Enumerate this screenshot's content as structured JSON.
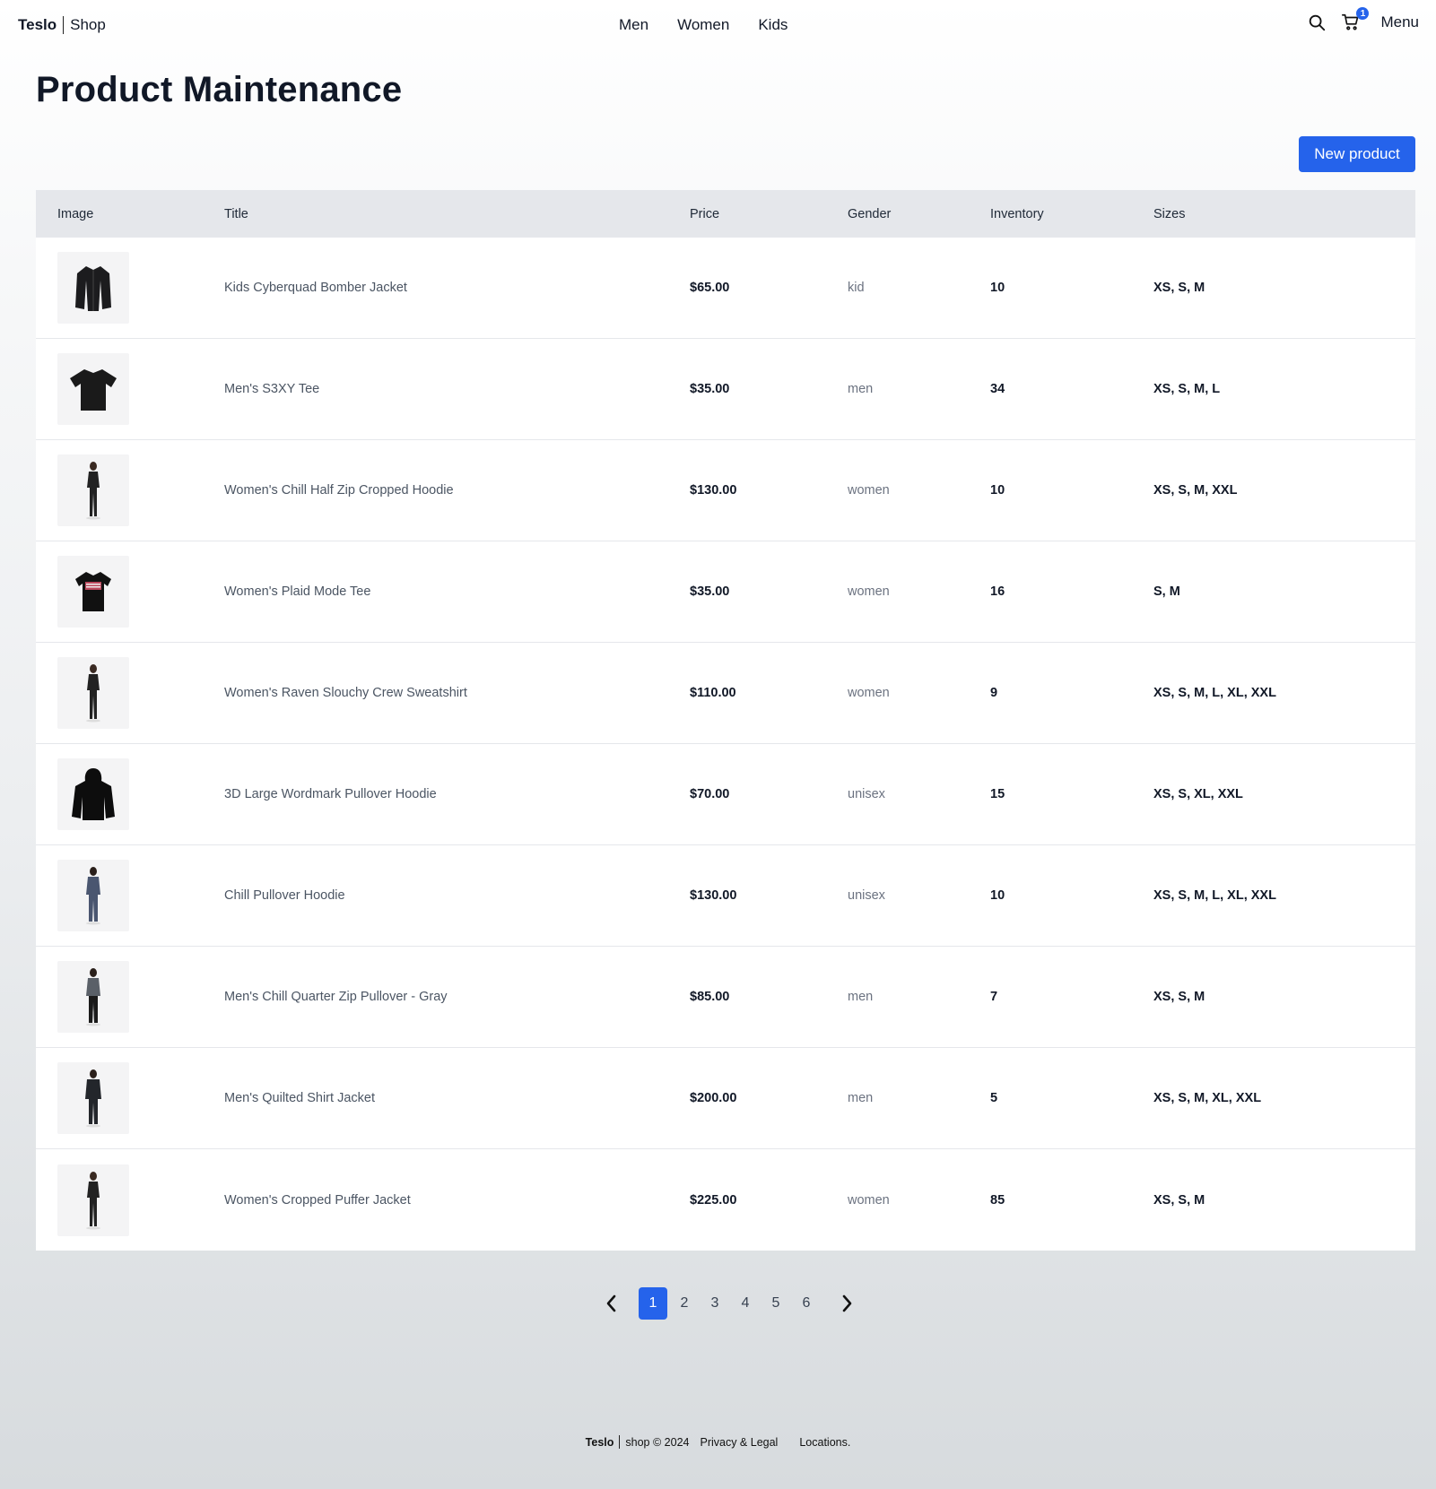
{
  "header": {
    "brand_bold": "Teslo",
    "brand_light": "Shop",
    "nav": [
      "Men",
      "Women",
      "Kids"
    ],
    "cart_count": "1",
    "menu_label": "Menu"
  },
  "page": {
    "title": "Product Maintenance",
    "new_button": "New product"
  },
  "table": {
    "columns": [
      "Image",
      "Title",
      "Price",
      "Gender",
      "Inventory",
      "Sizes"
    ],
    "rows": [
      {
        "image": "dark-jacket",
        "title": "Kids Cyberquad Bomber Jacket",
        "price": "$65.00",
        "gender": "kid",
        "inventory": "10",
        "sizes": "XS, S, M"
      },
      {
        "image": "black-tee",
        "title": "Men's S3XY Tee",
        "price": "$35.00",
        "gender": "men",
        "inventory": "34",
        "sizes": "XS, S, M, L"
      },
      {
        "image": "woman-model",
        "title": "Women's Chill Half Zip Cropped Hoodie",
        "price": "$130.00",
        "gender": "women",
        "inventory": "10",
        "sizes": "XS, S, M, XXL"
      },
      {
        "image": "black-tee-print",
        "title": "Women's Plaid Mode Tee",
        "price": "$35.00",
        "gender": "women",
        "inventory": "16",
        "sizes": "S, M"
      },
      {
        "image": "woman-model",
        "title": "Women's Raven Slouchy Crew Sweatshirt",
        "price": "$110.00",
        "gender": "women",
        "inventory": "9",
        "sizes": "XS, S, M, L, XL, XXL"
      },
      {
        "image": "black-hoodie",
        "title": "3D Large Wordmark Pullover Hoodie",
        "price": "$70.00",
        "gender": "unisex",
        "inventory": "15",
        "sizes": "XS, S, XL, XXL"
      },
      {
        "image": "model-blue",
        "title": "Chill Pullover Hoodie",
        "price": "$130.00",
        "gender": "unisex",
        "inventory": "10",
        "sizes": "XS, S, M, L, XL, XXL"
      },
      {
        "image": "model-gray",
        "title": "Men's Chill Quarter Zip Pullover - Gray",
        "price": "$85.00",
        "gender": "men",
        "inventory": "7",
        "sizes": "XS, S, M"
      },
      {
        "image": "model-dark",
        "title": "Men's Quilted Shirt Jacket",
        "price": "$200.00",
        "gender": "men",
        "inventory": "5",
        "sizes": "XS, S, M, XL, XXL"
      },
      {
        "image": "woman-model",
        "title": "Women's Cropped Puffer Jacket",
        "price": "$225.00",
        "gender": "women",
        "inventory": "85",
        "sizes": "XS, S, M"
      }
    ]
  },
  "pagination": {
    "pages": [
      "1",
      "2",
      "3",
      "4",
      "5",
      "6"
    ],
    "current": "1"
  },
  "footer": {
    "brand_bold": "Teslo",
    "brand_rest": "shop © 2024",
    "privacy": "Privacy & Legal",
    "locations": "Locations."
  },
  "colors": {
    "accent": "#2563eb",
    "header_row": "#e5e7eb"
  }
}
